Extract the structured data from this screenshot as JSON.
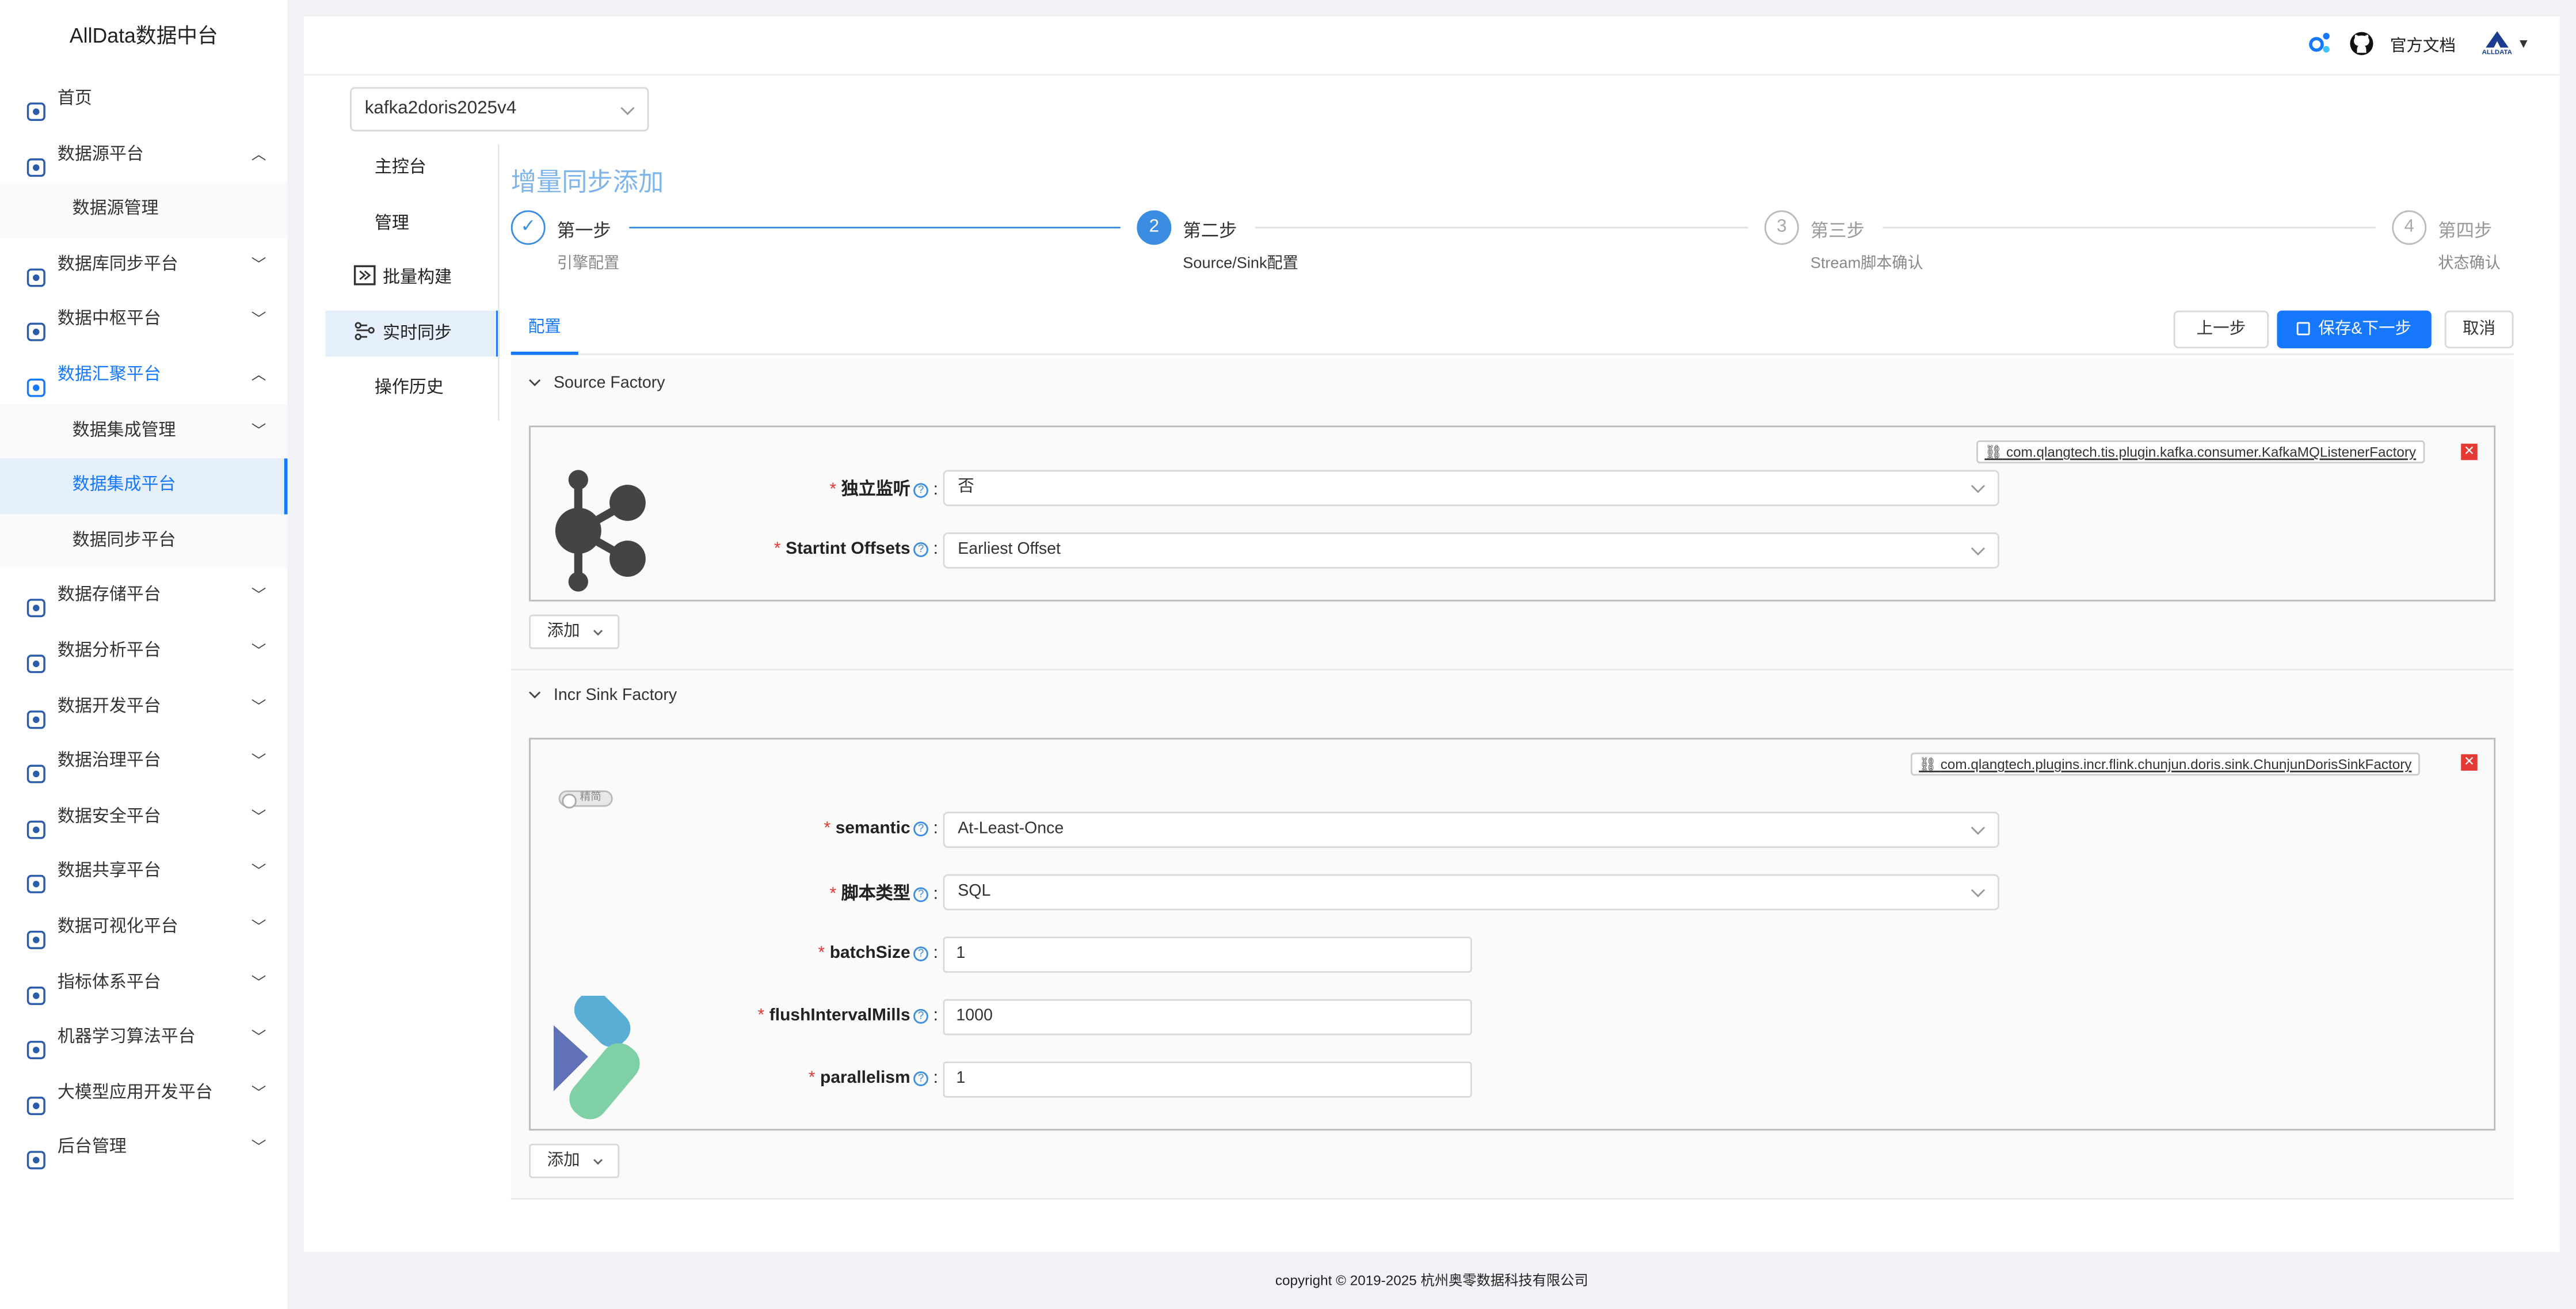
{
  "brand": "AllData数据中台",
  "sidebar": {
    "items": [
      {
        "label": "首页",
        "icon": "home-icon",
        "expand": ""
      },
      {
        "label": "数据源平台",
        "icon": "database-icon",
        "expand": "up"
      },
      {
        "label": "数据源管理",
        "sub": true,
        "expand": ""
      },
      {
        "label": "数据库同步平台",
        "icon": "sync-db-icon",
        "expand": "down"
      },
      {
        "label": "数据中枢平台",
        "icon": "hub-icon",
        "expand": "down"
      },
      {
        "label": "数据汇聚平台",
        "icon": "layers-icon",
        "expand": "up",
        "highlight": true
      },
      {
        "label": "数据集成管理",
        "sub": true,
        "expand": "down"
      },
      {
        "label": "数据集成平台",
        "sub": true,
        "active": true,
        "expand": ""
      },
      {
        "label": "数据同步平台",
        "sub": true,
        "expand": ""
      },
      {
        "label": "数据存储平台",
        "icon": "storage-icon",
        "expand": "down"
      },
      {
        "label": "数据分析平台",
        "icon": "analysis-icon",
        "expand": "down"
      },
      {
        "label": "数据开发平台",
        "icon": "dev-icon",
        "expand": "down"
      },
      {
        "label": "数据治理平台",
        "icon": "governance-icon",
        "expand": "down"
      },
      {
        "label": "数据安全平台",
        "icon": "security-icon",
        "expand": "down"
      },
      {
        "label": "数据共享平台",
        "icon": "share-icon",
        "expand": "down"
      },
      {
        "label": "数据可视化平台",
        "icon": "visual-icon",
        "expand": "down"
      },
      {
        "label": "指标体系平台",
        "icon": "metrics-icon",
        "expand": "down"
      },
      {
        "label": "机器学习算法平台",
        "icon": "ml-icon",
        "expand": "down"
      },
      {
        "label": "大模型应用开发平台",
        "icon": "llm-icon",
        "expand": "down"
      },
      {
        "label": "后台管理",
        "icon": "settings-icon",
        "expand": "down"
      }
    ]
  },
  "topbar": {
    "docs_label": "官方文档",
    "logo_text": "ALLDATA"
  },
  "pipeline_select": "kafka2doris2025v4",
  "pipeline_nav": [
    {
      "label": "主控台",
      "icon": ""
    },
    {
      "label": "管理",
      "icon": ""
    },
    {
      "label": "批量构建",
      "icon": "batch-build-icon"
    },
    {
      "label": "实时同步",
      "icon": "realtime-sync-icon",
      "active": true
    },
    {
      "label": "操作历史",
      "icon": ""
    }
  ],
  "page_title": "增量同步添加",
  "steps": [
    {
      "title": "第一步",
      "desc": "引擎配置",
      "num": "✓",
      "state": "done"
    },
    {
      "title": "第二步",
      "desc": "Source/Sink配置",
      "num": "2",
      "state": "active"
    },
    {
      "title": "第三步",
      "desc": "Stream脚本确认",
      "num": "3",
      "state": "wait"
    },
    {
      "title": "第四步",
      "desc": "状态确认",
      "num": "4",
      "state": "wait"
    }
  ],
  "tab_label": "配置",
  "buttons": {
    "prev": "上一步",
    "save_next": "保存&下一步",
    "cancel": "取消",
    "add": "添加"
  },
  "source": {
    "header": "Source Factory",
    "plugin": "com.qlangtech.tis.plugin.kafka.consumer.KafkaMQListenerFactory",
    "fields": [
      {
        "label": "独立监听",
        "type": "select",
        "value": "否"
      },
      {
        "label": "Startint Offsets",
        "type": "select",
        "value": "Earliest Offset"
      }
    ]
  },
  "sink": {
    "header": "Incr Sink Factory",
    "plugin": "com.qlangtech.plugins.incr.flink.chunjun.doris.sink.ChunjunDorisSinkFactory",
    "toggle_label": "精简",
    "fields": [
      {
        "label": "semantic",
        "type": "select",
        "value": "At-Least-Once"
      },
      {
        "label": "脚本类型",
        "type": "select",
        "value": "SQL"
      },
      {
        "label": "batchSize",
        "type": "input",
        "value": "1"
      },
      {
        "label": "flushIntervalMills",
        "type": "input",
        "value": "1000"
      },
      {
        "label": "parallelism",
        "type": "input",
        "value": "1"
      }
    ]
  },
  "footer": "copyright © 2019-2025 杭州奥零数据科技有限公司",
  "colors": {
    "primary": "#1677ff",
    "title": "#7fb5ea",
    "required": "#e53935"
  }
}
